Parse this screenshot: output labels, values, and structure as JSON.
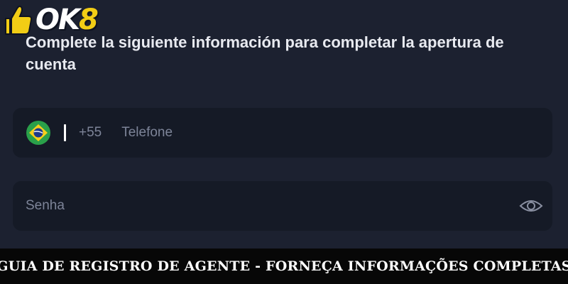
{
  "brand": {
    "name_main": "OK",
    "name_accent": "8",
    "icon": "thumbs-up-icon",
    "accent_color": "#f2cd15"
  },
  "form": {
    "heading": "Complete la siguiente información para completar la apertura de cuenta",
    "phone": {
      "flag_icon": "brazil-flag-icon",
      "country_code": "+55",
      "placeholder": "Telefone",
      "value": ""
    },
    "password": {
      "placeholder": "Senha",
      "value": "",
      "toggle_icon": "eye-icon"
    }
  },
  "banner": {
    "text": "GUIA DE REGISTRO DE AGENTE - FORNEÇA INFORMAÇÕES COMPLETAS"
  },
  "colors": {
    "background": "#1c2130",
    "field_background": "#151a26",
    "placeholder": "#7d8498",
    "banner_background": "#070707"
  }
}
